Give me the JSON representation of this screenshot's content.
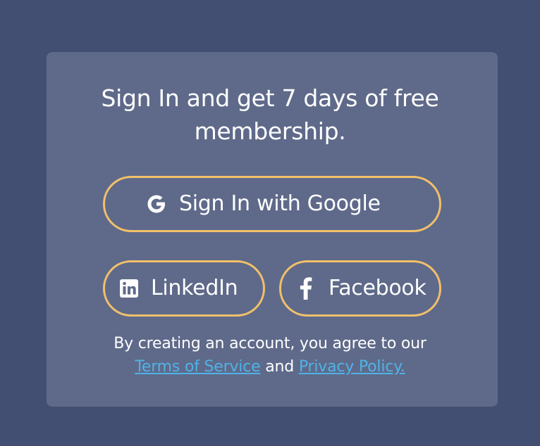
{
  "card": {
    "headline_line1": "Sign In and get 7 days of free",
    "headline_line2": "membership."
  },
  "buttons": {
    "google": {
      "label": "Sign In with Google",
      "icon": "google-icon"
    },
    "linkedin": {
      "label": "LinkedIn",
      "icon": "linkedin-icon"
    },
    "facebook": {
      "label": "Facebook",
      "icon": "facebook-icon"
    }
  },
  "legal": {
    "prefix": "By creating an account, you agree to our",
    "terms_link": "Terms of Service",
    "conjunction": "and",
    "privacy_link": "Privacy Policy."
  },
  "colors": {
    "page_background": "#424f72",
    "card_background": "#5f6a8a",
    "button_border": "#f2c06a",
    "link": "#4fb3e6",
    "text": "#ffffff"
  }
}
